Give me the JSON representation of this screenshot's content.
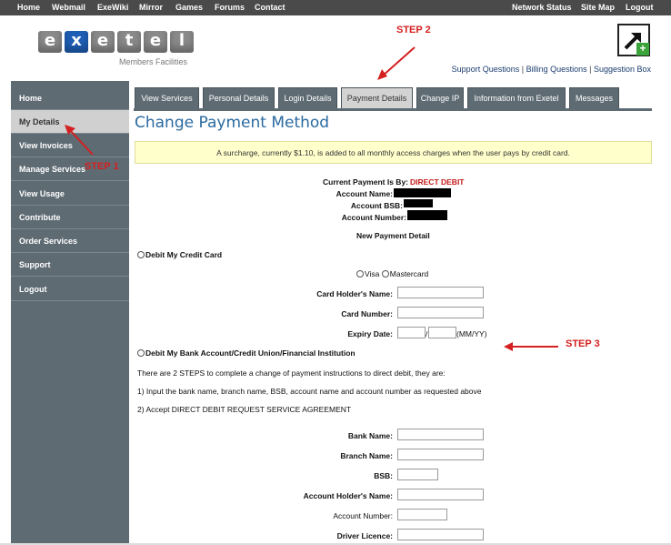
{
  "topnav": {
    "left": [
      "Home",
      "Webmail",
      "ExeWiki",
      "Mirror",
      "Games",
      "Forums",
      "Contact"
    ],
    "right": [
      "Network Status",
      "Site Map",
      "Logout"
    ]
  },
  "header": {
    "logo_letters": [
      "e",
      "x",
      "e",
      "t",
      "e",
      "l"
    ],
    "logo_sub": "Members Facilities",
    "links": [
      "Support Questions",
      "Billing Questions",
      "Suggestion Box"
    ],
    "link_sep": " | "
  },
  "annotations": {
    "step1": "STEP 1",
    "step2": "STEP 2",
    "step3": "STEP 3",
    "color": "#d42020"
  },
  "sidebar": {
    "items": [
      {
        "label": "Home"
      },
      {
        "label": "My Details",
        "active": true
      },
      {
        "label": "View Invoices"
      },
      {
        "label": "Manage Services"
      },
      {
        "label": "View Usage"
      },
      {
        "label": "Contribute"
      },
      {
        "label": "Order Services"
      },
      {
        "label": "Support"
      },
      {
        "label": "Logout"
      }
    ]
  },
  "tabs": [
    {
      "label": "View Services"
    },
    {
      "label": "Personal Details"
    },
    {
      "label": "Login Details"
    },
    {
      "label": "Payment Details",
      "active": true
    },
    {
      "label": "Change IP"
    },
    {
      "label": "Information from Exetel"
    },
    {
      "label": "Messages"
    }
  ],
  "page": {
    "title": "Change Payment Method",
    "notice": "A surcharge, currently $1.10, is added to all monthly access charges when the user pays by credit card."
  },
  "current": {
    "payment_label": "Current Payment Is By:",
    "payment_value": "DIRECT DEBIT",
    "account_name_label": "Account Name:",
    "account_bsb_label": "Account BSB:",
    "account_number_label": "Account Number:"
  },
  "new_payment": {
    "heading": "New Payment Detail",
    "credit_option": "Debit My Credit Card",
    "card_types": [
      "Visa",
      "Mastercard"
    ],
    "card_holder_label": "Card Holder's Name:",
    "card_number_label": "Card Number:",
    "expiry_label": "Expiry Date:",
    "expiry_sep": "/",
    "expiry_hint": "(MM/YY)",
    "bank_option": "Debit My Bank Account/Credit Union/Financial Institution",
    "steps_intro": "There are 2 STEPS to complete a change of payment instructions to direct debit, they are:",
    "step_one": "1) Input the bank name, branch name, BSB, account name and account number as requested above",
    "step_two": "2) Accept DIRECT DEBIT REQUEST SERVICE AGREEMENT",
    "bank_name_label": "Bank Name:",
    "branch_name_label": "Branch Name:",
    "bsb_label": "BSB:",
    "account_holder_label": "Account Holder's Name:",
    "account_number_label": "Account Number:",
    "driver_licence_label": "Driver Licence:"
  }
}
